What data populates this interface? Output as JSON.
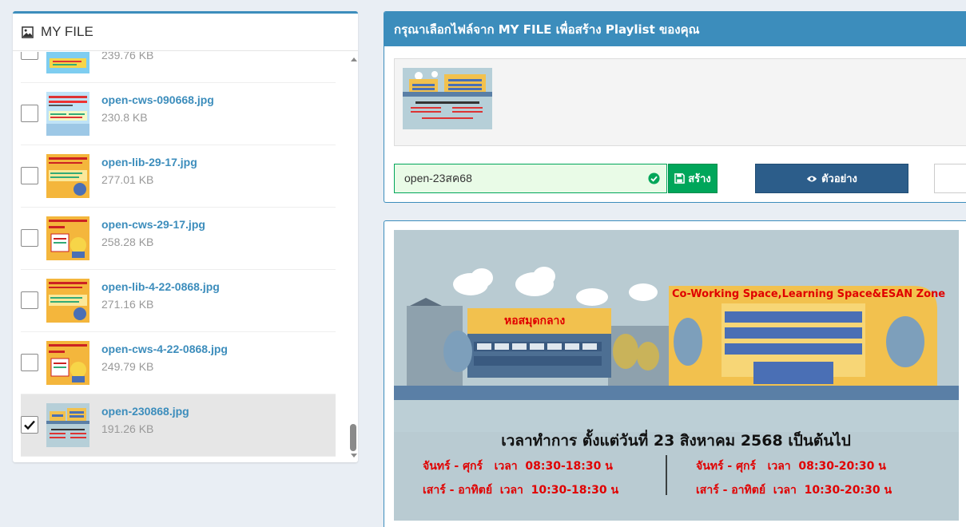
{
  "my_file": {
    "title": "MY FILE",
    "items": [
      {
        "name": "",
        "size": "239.76 KB",
        "checked": false
      },
      {
        "name": "open-cws-090668.jpg",
        "size": "230.8 KB",
        "checked": false
      },
      {
        "name": "open-lib-29-17.jpg",
        "size": "277.01 KB",
        "checked": false
      },
      {
        "name": "open-cws-29-17.jpg",
        "size": "258.28 KB",
        "checked": false
      },
      {
        "name": "open-lib-4-22-0868.jpg",
        "size": "271.16 KB",
        "checked": false
      },
      {
        "name": "open-cws-4-22-0868.jpg",
        "size": "249.79 KB",
        "checked": false
      },
      {
        "name": "open-230868.jpg",
        "size": "191.26 KB",
        "checked": true
      }
    ]
  },
  "playlist": {
    "header": "กรุณาเลือกไฟล์จาก MY FILE เพื่อสร้าง Playlist ของคุณ",
    "name_value": "open-23สค68",
    "create_label": "สร้าง",
    "preview_label": "ตัวอย่าง"
  },
  "poster": {
    "zone_title": "Co-Working Space,Learning Space&ESAN Zone",
    "library_label": "หอสมุดกลาง",
    "hours_title": "เวลาทำการ ตั้งแต่วันที่ 23 สิงหาคม 2568 เป็นต้นไป",
    "left_weekday": "จันทร์ - ศุกร์   เวลา  08:30-18:30 น",
    "left_weekend": "เสาร์ - อาทิตย์  เวลา  10:30-18:30 น",
    "right_weekday": "จันทร์ - ศุกร์   เวลา  08:30-20:30 น",
    "right_weekend": "เสาร์ - อาทิตย์  เวลา  10:30-20:30 น"
  },
  "colors": {
    "primary": "#3c8dbc",
    "success": "#00a65a",
    "preview_button": "#2c5d8a",
    "poster_red": "#e00000",
    "poster_yellow": "#f2c14e"
  },
  "icons": {
    "header": "image-file-icon",
    "valid": "check-circle-icon",
    "create": "save-icon",
    "preview": "eye-icon"
  }
}
